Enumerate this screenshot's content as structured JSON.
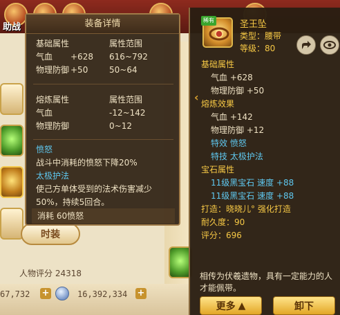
{
  "background": {
    "top_label": "助战",
    "fashion_button": "时装",
    "rating_label": "人物评分",
    "rating_value": "24318",
    "currency_left": "67,732",
    "currency_right": "16,392,334"
  },
  "detail": {
    "title": "装备详情",
    "base": {
      "header_attr": "基础属性",
      "header_range": "属性范围",
      "rows": [
        {
          "name": "气血",
          "value": "+628",
          "range": "616~792"
        },
        {
          "name": "物理防御",
          "value": "+50",
          "range": "50~64"
        }
      ]
    },
    "refine": {
      "header_attr": "熔炼属性",
      "header_range": "属性范围",
      "rows": [
        {
          "name": "气血",
          "value": "",
          "range": "-12~142"
        },
        {
          "name": "物理防御",
          "value": "",
          "range": "0~12"
        }
      ]
    },
    "anger": {
      "title": "愤怒",
      "desc": "战斗中消耗的愤怒下降20%",
      "skill": "太极护法",
      "skill_desc_1": "使己方单体受到的法术伤害减少",
      "skill_desc_2": "50%，持续5回合。",
      "cost": "消耗 60愤怒"
    }
  },
  "item": {
    "badge": "稀有",
    "name": "圣王坠",
    "type": "类型：腰带",
    "level": "等级：80",
    "base_header": "基础属性",
    "base": [
      "气血 +628",
      "物理防御 +50"
    ],
    "refine_header": "熔炼效果",
    "refine": [
      "气血 +142",
      "物理防御 +12"
    ],
    "effect": "特效 愤怒",
    "skill": "特技 太极护法",
    "gem_header": "宝石属性",
    "gems": [
      "11级黑宝石  速度 +88",
      "11级黑宝石  速度 +88"
    ],
    "maker": "打造：晓晓儿°    强化打造",
    "durability": "耐久度：90",
    "score": "评分：696",
    "lore": "相传为伏羲遗物，具有一定能力的人才能佩带。",
    "btn_more": "更多",
    "btn_unequip": "卸下"
  }
}
